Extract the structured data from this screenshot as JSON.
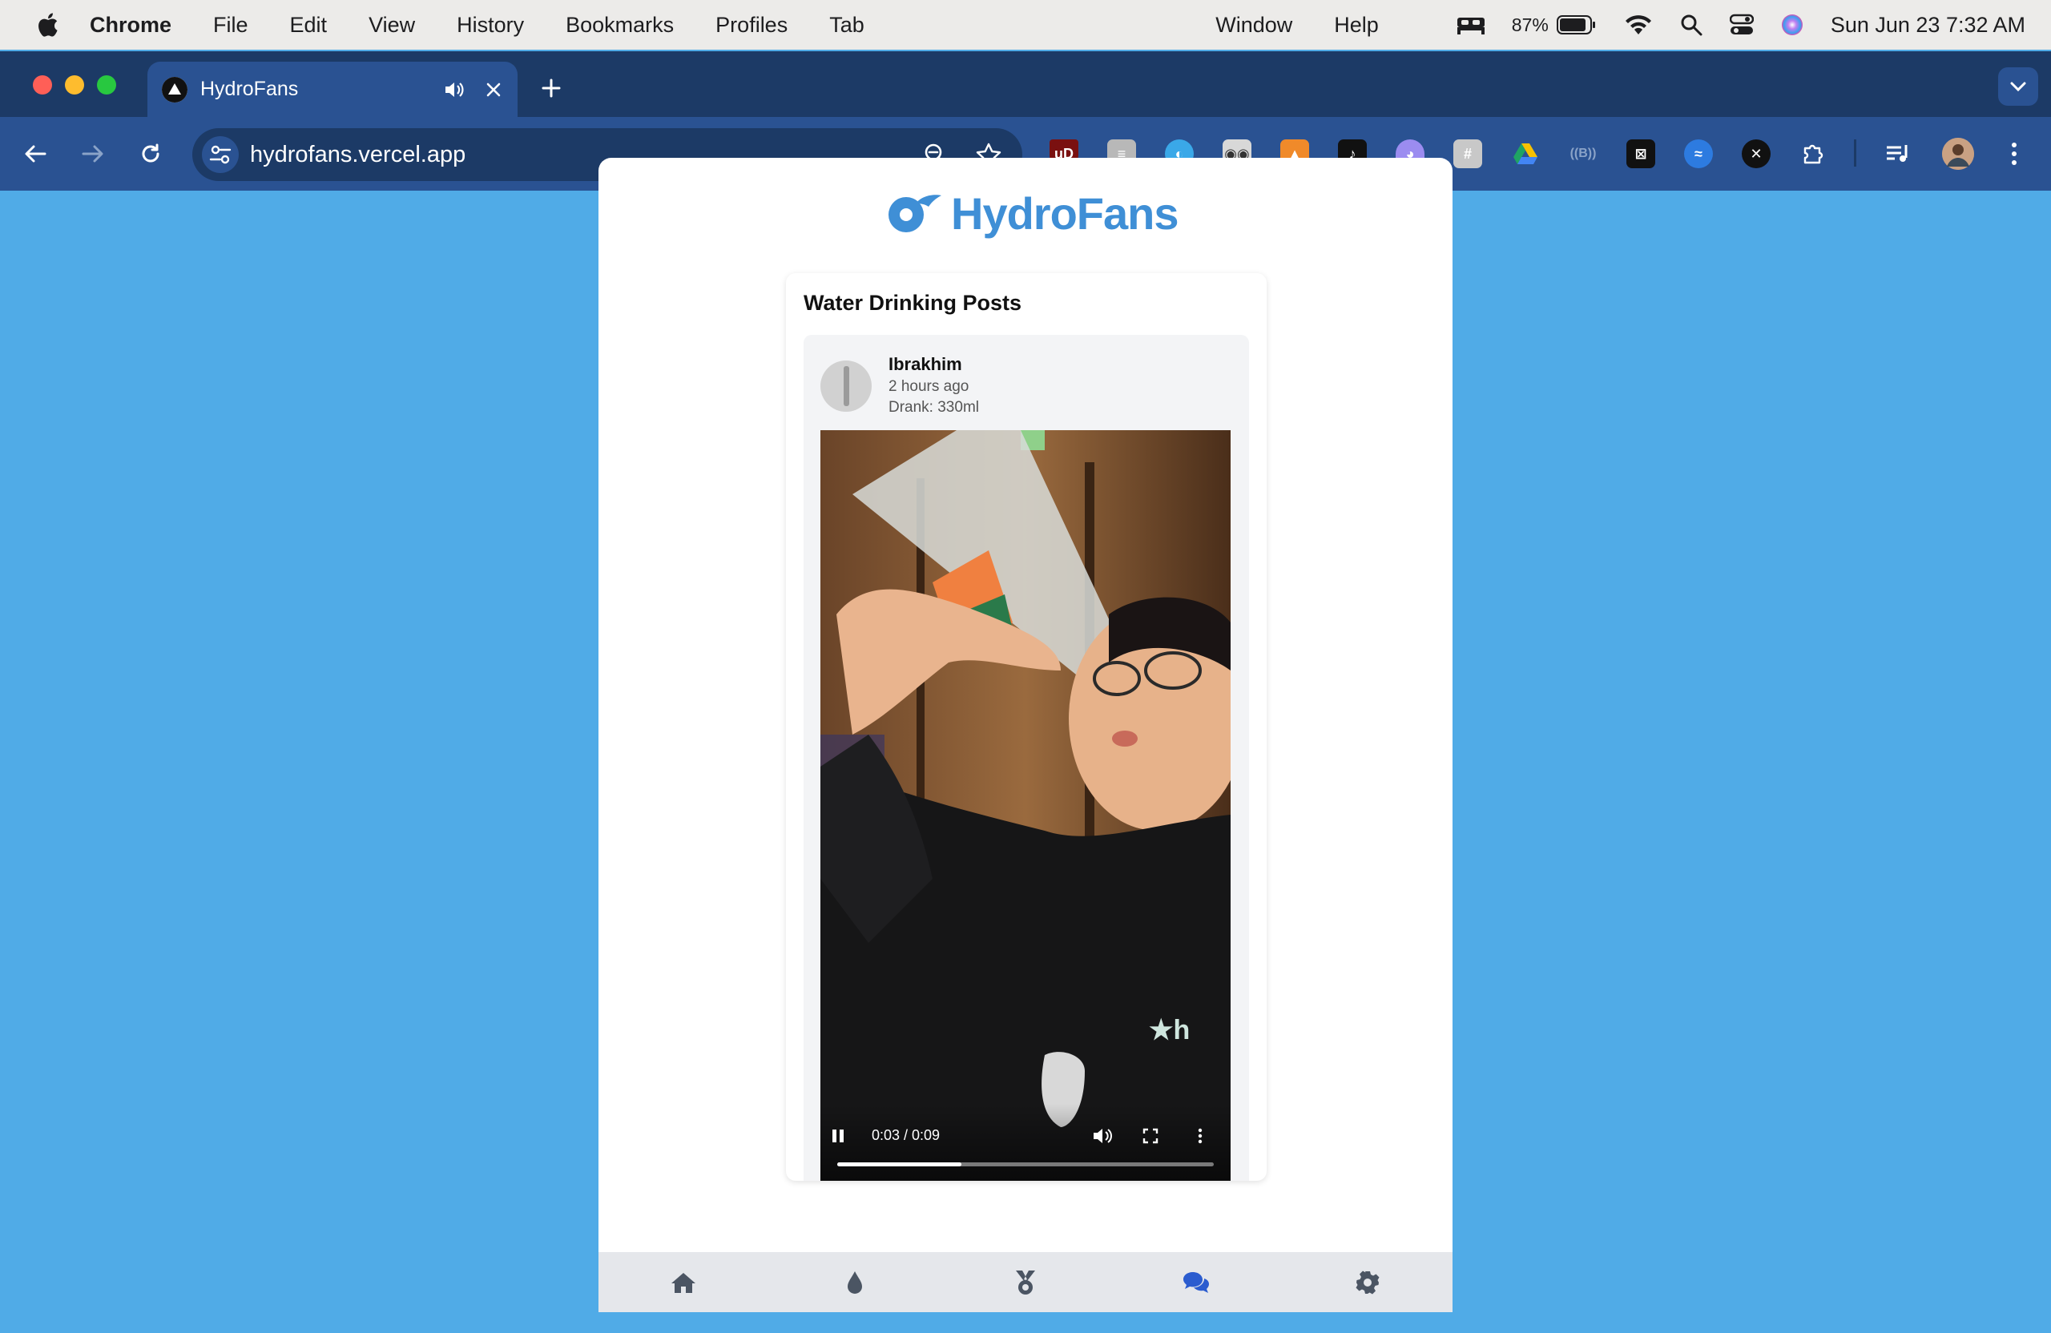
{
  "menubar": {
    "app": "Chrome",
    "items": [
      "File",
      "Edit",
      "View",
      "History",
      "Bookmarks",
      "Profiles",
      "Tab"
    ],
    "right_items": [
      "Window",
      "Help"
    ],
    "battery": "87%",
    "datetime": "Sun Jun 23  7:32 AM"
  },
  "browser": {
    "tab_title": "HydroFans",
    "url": "hydrofans.vercel.app",
    "icons": {
      "audio": "speaker-icon",
      "close": "close-icon",
      "new_tab": "plus-icon",
      "back": "back-arrow-icon",
      "forward": "forward-arrow-icon",
      "reload": "reload-icon",
      "zoom": "zoom-out-icon",
      "bookmark": "star-icon",
      "extensions": "puzzle-icon",
      "media": "media-control-icon",
      "menu": "kebab-menu-icon"
    }
  },
  "app": {
    "brand": "HydroFans",
    "feed_title": "Water Drinking Posts",
    "post": {
      "username": "Ibrakhim",
      "time": "2 hours ago",
      "amount": "Drank: 330ml",
      "video": {
        "time_label": "0:03 / 0:09",
        "progress": 0.33
      }
    },
    "nav": [
      "home-icon",
      "water-drop-icon",
      "medal-icon",
      "chat-icon",
      "gear-icon"
    ],
    "nav_active": 3
  },
  "colors": {
    "page_bg": "#50abe7",
    "brand": "#3f8fd6",
    "nav_active": "#2b5ccf",
    "nav_inactive": "#4b5563"
  }
}
